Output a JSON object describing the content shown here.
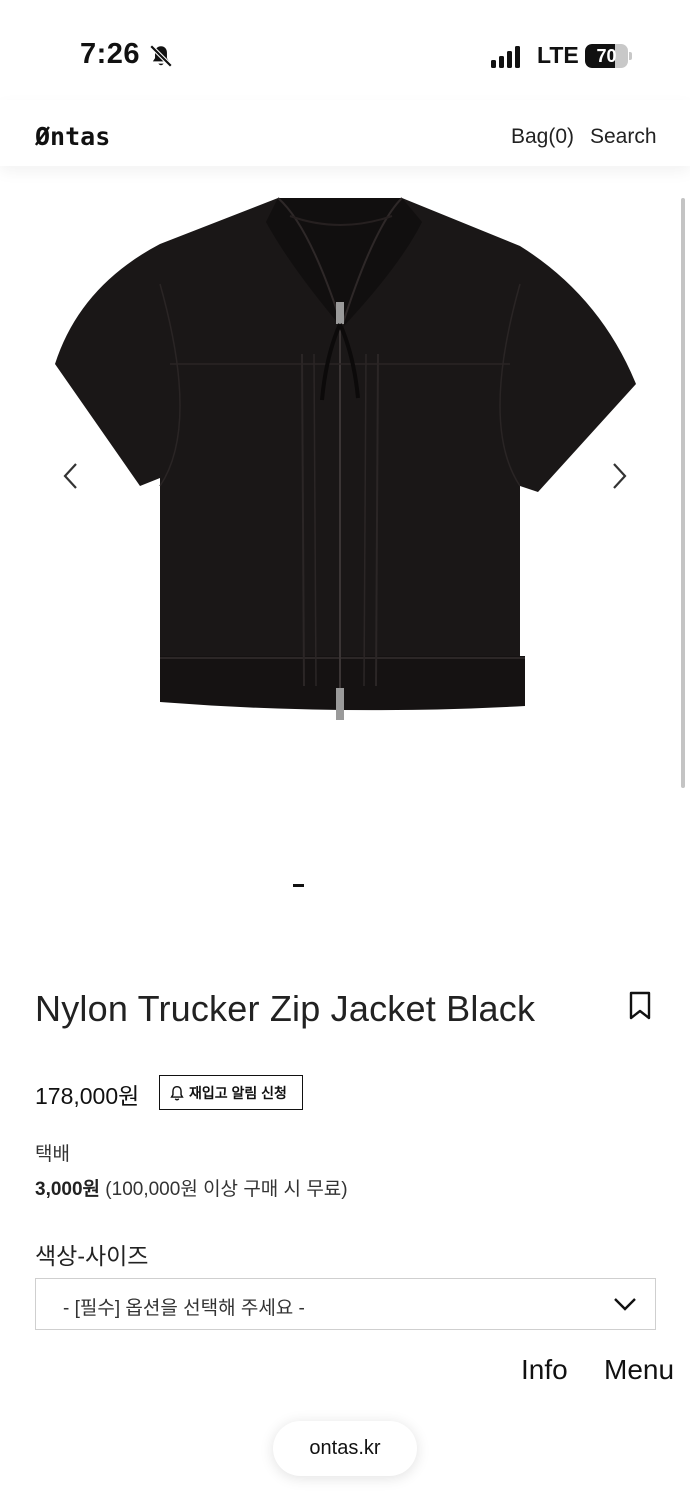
{
  "status_bar": {
    "time": "7:26",
    "network": "LTE",
    "battery_percent": "70",
    "battery_level": 0.7,
    "icons": [
      "bell-slash-icon",
      "signal-bars-icon",
      "battery-icon"
    ]
  },
  "header": {
    "logo": "Øntas",
    "bag": "Bag(0)",
    "search": "Search"
  },
  "gallery": {
    "image": "black-short-sleeve-zip-jacket",
    "prev_icon": "chevron-left-icon",
    "next_icon": "chevron-right-icon"
  },
  "product": {
    "title": "Nylon Trucker Zip Jacket Black",
    "bookmark_icon": "bookmark-icon",
    "price": "178,000원",
    "restock_button": "재입고 알림 신청",
    "shipping_label": "택배",
    "shipping_fee": "3,000원",
    "shipping_note": " (100,000원 이상 구매 시 무료)",
    "option_label": "색상-사이즈",
    "option_placeholder": "- [필수] 옵션을 선택해 주세요 -"
  },
  "bottom_nav": {
    "info": "Info",
    "menu": "Menu"
  },
  "browser": {
    "url": "ontas.kr"
  },
  "colors": {
    "text": "#111111",
    "garment": "#1a1717",
    "border": "#cfcfcf"
  }
}
